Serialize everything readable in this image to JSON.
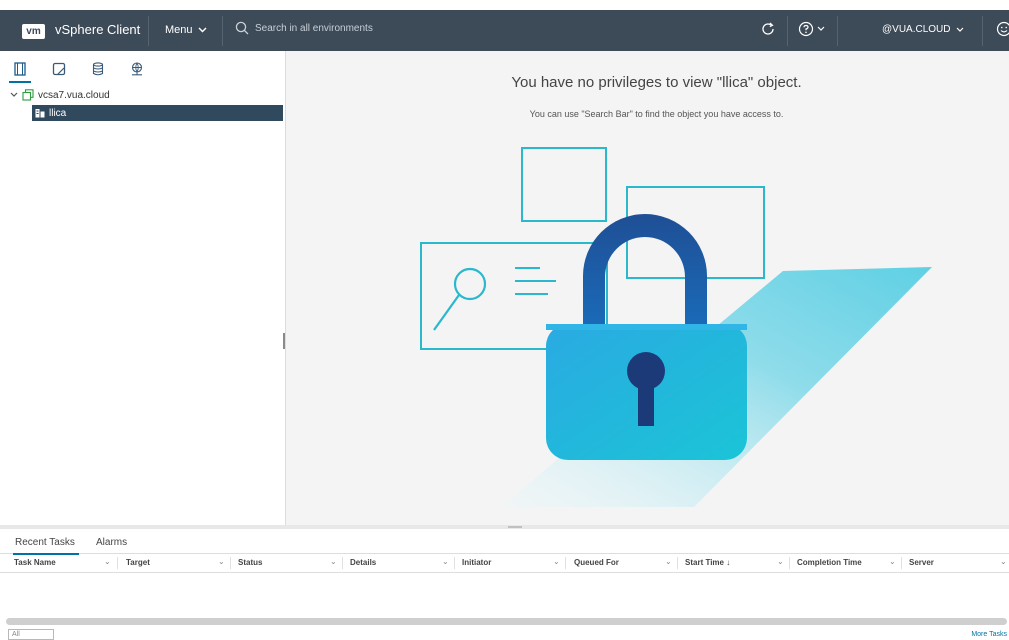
{
  "header": {
    "logo": "vm",
    "app_title": "vSphere Client",
    "menu_label": "Menu",
    "search_placeholder": "Search in all environments",
    "user_label": "@VUA.CLOUD"
  },
  "nav": {
    "tabs": [
      "hosts-and-clusters-icon",
      "vms-and-templates-icon",
      "storage-icon",
      "networking-icon"
    ],
    "tree": {
      "root_label": "vcsa7.vua.cloud",
      "child_label": "llica"
    }
  },
  "main": {
    "title": "You have no privileges to view \"llica\" object.",
    "subtitle": "You can use \"Search Bar\" to find the object you have access to."
  },
  "bottom": {
    "tabs": [
      "Recent Tasks",
      "Alarms"
    ],
    "columns": [
      "Task Name",
      "Target",
      "Status",
      "Details",
      "Initiator",
      "Queued For",
      "Start Time ↓",
      "Completion Time",
      "Server"
    ],
    "select_value": "All",
    "more_tasks": "More Tasks"
  },
  "colors": {
    "header_bg": "#3d4a58",
    "selected_bg": "#31495d",
    "accent": "#0072a3",
    "illustration_cyan": "#29b8cc",
    "lock_blue": "#1a4f9c"
  }
}
